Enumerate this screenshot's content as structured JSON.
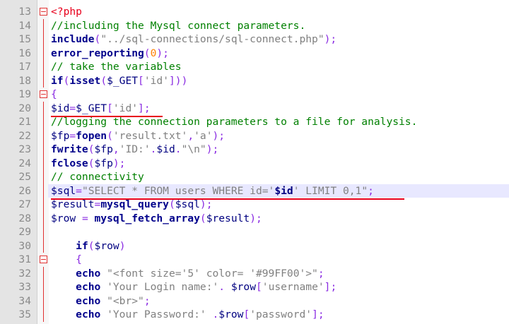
{
  "lines": [
    {
      "n": "13",
      "t": [
        {
          "c": "tag",
          "s": "<?php"
        }
      ]
    },
    {
      "n": "14",
      "t": [
        {
          "c": "cm",
          "s": "//including the Mysql connect parameters."
        }
      ]
    },
    {
      "n": "15",
      "t": [
        {
          "c": "kw",
          "s": "include"
        },
        {
          "c": "op",
          "s": "("
        },
        {
          "c": "st",
          "s": "\"../sql-connections/sql-connect.php\""
        },
        {
          "c": "op",
          "s": ");"
        }
      ]
    },
    {
      "n": "16",
      "t": [
        {
          "c": "kw",
          "s": "error_reporting"
        },
        {
          "c": "op",
          "s": "("
        },
        {
          "c": "num",
          "s": "0"
        },
        {
          "c": "op",
          "s": ");"
        }
      ]
    },
    {
      "n": "17",
      "t": [
        {
          "c": "cm",
          "s": "// take the variables"
        }
      ]
    },
    {
      "n": "18",
      "t": [
        {
          "c": "kw",
          "s": "if"
        },
        {
          "c": "op",
          "s": "("
        },
        {
          "c": "kw",
          "s": "isset"
        },
        {
          "c": "op",
          "s": "("
        },
        {
          "c": "var",
          "s": "$_GET"
        },
        {
          "c": "op",
          "s": "["
        },
        {
          "c": "st",
          "s": "'id'"
        },
        {
          "c": "op",
          "s": "]))"
        }
      ]
    },
    {
      "n": "19",
      "t": [
        {
          "c": "op",
          "s": "{"
        }
      ]
    },
    {
      "n": "20",
      "t": [
        {
          "c": "var",
          "s": "$id"
        },
        {
          "c": "op",
          "s": "="
        },
        {
          "c": "var",
          "s": "$_GET"
        },
        {
          "c": "op",
          "s": "["
        },
        {
          "c": "st",
          "s": "'id'"
        },
        {
          "c": "op",
          "s": "];"
        }
      ]
    },
    {
      "n": "21",
      "t": [
        {
          "c": "cm",
          "s": "//logging the connection parameters to a file for analysis."
        }
      ]
    },
    {
      "n": "22",
      "t": [
        {
          "c": "var",
          "s": "$fp"
        },
        {
          "c": "op",
          "s": "="
        },
        {
          "c": "kw",
          "s": "fopen"
        },
        {
          "c": "op",
          "s": "("
        },
        {
          "c": "st",
          "s": "'result.txt'"
        },
        {
          "c": "op",
          "s": ","
        },
        {
          "c": "st",
          "s": "'a'"
        },
        {
          "c": "op",
          "s": ");"
        }
      ]
    },
    {
      "n": "23",
      "t": [
        {
          "c": "kw",
          "s": "fwrite"
        },
        {
          "c": "op",
          "s": "("
        },
        {
          "c": "var",
          "s": "$fp"
        },
        {
          "c": "op",
          "s": ","
        },
        {
          "c": "st",
          "s": "'ID:'"
        },
        {
          "c": "op",
          "s": "."
        },
        {
          "c": "var",
          "s": "$id"
        },
        {
          "c": "op",
          "s": "."
        },
        {
          "c": "st",
          "s": "\"\\n\""
        },
        {
          "c": "op",
          "s": ");"
        }
      ]
    },
    {
      "n": "24",
      "t": [
        {
          "c": "kw",
          "s": "fclose"
        },
        {
          "c": "op",
          "s": "("
        },
        {
          "c": "var",
          "s": "$fp"
        },
        {
          "c": "op",
          "s": ");"
        }
      ]
    },
    {
      "n": "25",
      "t": [
        {
          "c": "cm",
          "s": "// connectivity"
        }
      ]
    },
    {
      "n": "26",
      "t": [
        {
          "c": "var",
          "s": "$sql"
        },
        {
          "c": "op",
          "s": "="
        },
        {
          "c": "st",
          "s": "\"SELECT * FROM users WHERE id='"
        },
        {
          "c": "vs",
          "s": "$id"
        },
        {
          "c": "st",
          "s": "' LIMIT 0,1\""
        },
        {
          "c": "op",
          "s": ";"
        }
      ]
    },
    {
      "n": "27",
      "t": [
        {
          "c": "var",
          "s": "$result"
        },
        {
          "c": "op",
          "s": "="
        },
        {
          "c": "kw",
          "s": "mysql_query"
        },
        {
          "c": "op",
          "s": "("
        },
        {
          "c": "var",
          "s": "$sql"
        },
        {
          "c": "op",
          "s": ");"
        }
      ]
    },
    {
      "n": "28",
      "t": [
        {
          "c": "var",
          "s": "$row"
        },
        {
          "c": "op",
          "s": " = "
        },
        {
          "c": "kw",
          "s": "mysql_fetch_array"
        },
        {
          "c": "op",
          "s": "("
        },
        {
          "c": "var",
          "s": "$result"
        },
        {
          "c": "op",
          "s": ");"
        }
      ]
    },
    {
      "n": "29",
      "t": []
    },
    {
      "n": "30",
      "t": [
        {
          "c": "op",
          "s": "    "
        },
        {
          "c": "kw",
          "s": "if"
        },
        {
          "c": "op",
          "s": "("
        },
        {
          "c": "var",
          "s": "$row"
        },
        {
          "c": "op",
          "s": ")"
        }
      ]
    },
    {
      "n": "31",
      "t": [
        {
          "c": "op",
          "s": "    {"
        }
      ]
    },
    {
      "n": "32",
      "t": [
        {
          "c": "op",
          "s": "    "
        },
        {
          "c": "kw",
          "s": "echo"
        },
        {
          "c": "op",
          "s": " "
        },
        {
          "c": "st",
          "s": "\"<font size='5' color= '#99FF00'>\""
        },
        {
          "c": "op",
          "s": ";"
        }
      ]
    },
    {
      "n": "33",
      "t": [
        {
          "c": "op",
          "s": "    "
        },
        {
          "c": "kw",
          "s": "echo"
        },
        {
          "c": "op",
          "s": " "
        },
        {
          "c": "st",
          "s": "'Your Login name:'"
        },
        {
          "c": "op",
          "s": ". "
        },
        {
          "c": "var",
          "s": "$row"
        },
        {
          "c": "op",
          "s": "["
        },
        {
          "c": "st",
          "s": "'username'"
        },
        {
          "c": "op",
          "s": "];"
        }
      ]
    },
    {
      "n": "34",
      "t": [
        {
          "c": "op",
          "s": "    "
        },
        {
          "c": "kw",
          "s": "echo"
        },
        {
          "c": "op",
          "s": " "
        },
        {
          "c": "st",
          "s": "\"<br>\""
        },
        {
          "c": "op",
          "s": ";"
        }
      ]
    },
    {
      "n": "35",
      "t": [
        {
          "c": "op",
          "s": "    "
        },
        {
          "c": "kw",
          "s": "echo"
        },
        {
          "c": "op",
          "s": " "
        },
        {
          "c": "st",
          "s": "'Your Password:'"
        },
        {
          "c": "op",
          "s": " ."
        },
        {
          "c": "var",
          "s": "$row"
        },
        {
          "c": "op",
          "s": "["
        },
        {
          "c": "st",
          "s": "'password'"
        },
        {
          "c": "op",
          "s": "];"
        }
      ]
    }
  ]
}
